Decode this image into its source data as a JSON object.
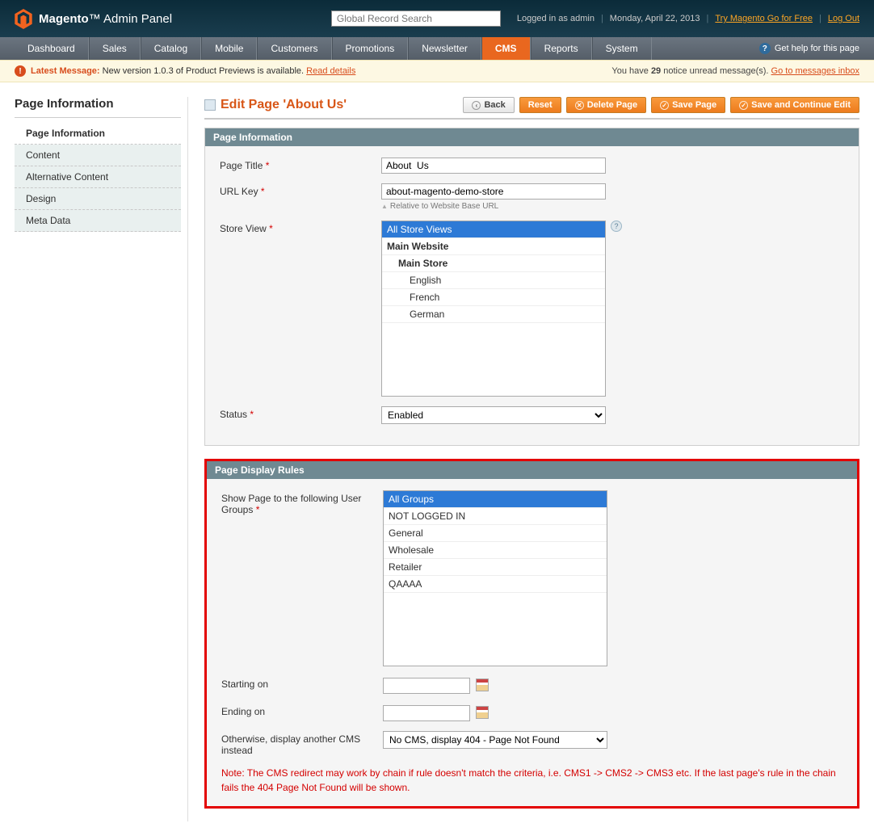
{
  "header": {
    "brand1": "Magento",
    "brand2": "Admin Panel",
    "search_placeholder": "Global Record Search",
    "logged_in": "Logged in as admin",
    "date": "Monday, April 22, 2013",
    "try_link": "Try Magento Go for Free",
    "logout": "Log Out"
  },
  "nav": {
    "items": [
      "Dashboard",
      "Sales",
      "Catalog",
      "Mobile",
      "Customers",
      "Promotions",
      "Newsletter",
      "CMS",
      "Reports",
      "System"
    ],
    "active": "CMS",
    "help": "Get help for this page"
  },
  "notice": {
    "label": "Latest Message:",
    "msg": "New version 1.0.3 of Product Previews is available.",
    "read": "Read details",
    "right1": "You have ",
    "right_count": "29",
    "right2": " notice unread message(s). ",
    "inbox": "Go to messages inbox"
  },
  "side": {
    "title": "Page Information",
    "tabs": [
      "Page Information",
      "Content",
      "Alternative Content",
      "Design",
      "Meta Data"
    ],
    "active": "Page Information"
  },
  "page": {
    "title": "Edit Page 'About Us'",
    "btns": {
      "back": "Back",
      "reset": "Reset",
      "delete": "Delete Page",
      "save": "Save Page",
      "savec": "Save and Continue Edit"
    }
  },
  "f1": {
    "head": "Page Information",
    "title_lbl": "Page Title",
    "title_val": "About  Us",
    "url_lbl": "URL Key",
    "url_val": "about-magento-demo-store",
    "url_note": "Relative to Website Base URL",
    "store_lbl": "Store View",
    "store_opts": [
      {
        "t": "All Store Views",
        "sel": true,
        "cls": ""
      },
      {
        "t": "Main Website",
        "cls": "group"
      },
      {
        "t": "Main Store",
        "cls": "sub1"
      },
      {
        "t": "English",
        "cls": "sub2"
      },
      {
        "t": "French",
        "cls": "sub2"
      },
      {
        "t": "German",
        "cls": "sub2"
      }
    ],
    "status_lbl": "Status",
    "status_val": "Enabled"
  },
  "f2": {
    "head": "Page Display Rules",
    "groups_lbl": "Show Page to the following User Groups",
    "groups_opts": [
      {
        "t": "All Groups",
        "sel": true
      },
      {
        "t": "NOT LOGGED IN"
      },
      {
        "t": "General"
      },
      {
        "t": "Wholesale"
      },
      {
        "t": "Retailer"
      },
      {
        "t": "QAAAA"
      }
    ],
    "start_lbl": "Starting on",
    "end_lbl": "Ending on",
    "other_lbl": "Otherwise, display another CMS instead",
    "other_val": "No CMS, display 404 - Page Not Found",
    "note": "Note: The CMS redirect may work by chain if rule doesn't match the criteria, i.e. CMS1 -> CMS2 -> CMS3 etc. If the last page's rule in the chain fails the 404 Page Not Found will be shown."
  }
}
